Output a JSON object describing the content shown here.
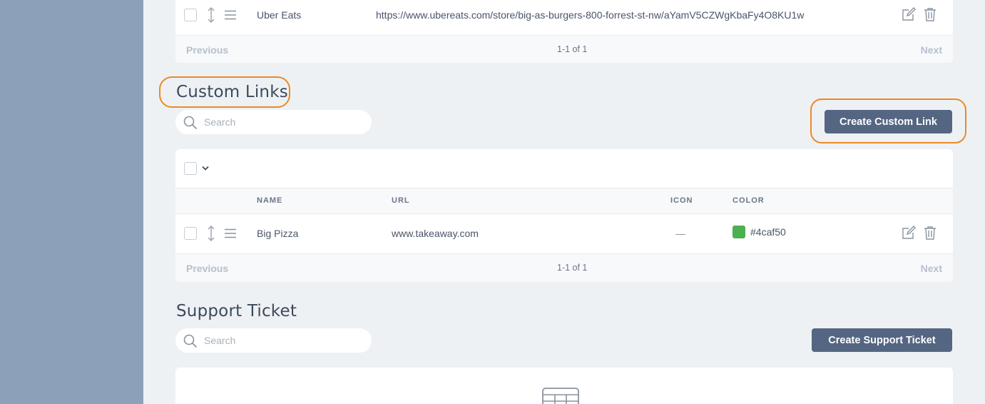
{
  "delivery_links": {
    "rows": [
      {
        "name": "Uber Eats",
        "url": "https://www.ubereats.com/store/big-as-burgers-800-forrest-st-nw/aYamV5CZWgKbaFy4O8KU1w"
      }
    ],
    "pager": {
      "previous": "Previous",
      "count": "1-1 of 1",
      "next": "Next"
    }
  },
  "custom_links": {
    "title": "Custom Links",
    "search_placeholder": "Search",
    "create_button": "Create Custom Link",
    "columns": {
      "name": "NAME",
      "url": "URL",
      "icon": "ICON",
      "color": "COLOR"
    },
    "rows": [
      {
        "name": "Big Pizza",
        "url": "www.takeaway.com",
        "icon": "—",
        "color": "#4caf50"
      }
    ],
    "pager": {
      "previous": "Previous",
      "count": "1-1 of 1",
      "next": "Next"
    }
  },
  "support_ticket": {
    "title": "Support Ticket",
    "search_placeholder": "Search",
    "create_button": "Create Support Ticket",
    "empty_icon": "table-icon"
  },
  "colors": {
    "sidebar": "#8da0ba",
    "background": "#eef1f4",
    "primary_button": "#546682",
    "highlight": "#ea8a26",
    "swatch": "#4caf50"
  }
}
